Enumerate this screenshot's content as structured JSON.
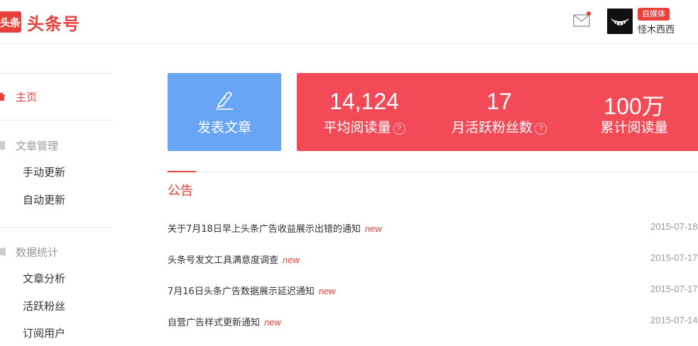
{
  "header": {
    "logo_mark": "头条",
    "logo_text": "头条号",
    "badge": "自媒体",
    "username": "怪木西西",
    "icons": [
      "mail-icon",
      "avatar"
    ]
  },
  "sidebar": {
    "home": "主页",
    "groups": [
      {
        "title": "文章管理",
        "items": [
          "手动更新",
          "自动更新"
        ]
      },
      {
        "title": "数据统计",
        "items": [
          "文章分析",
          "活跃粉丝",
          "订阅用户"
        ]
      }
    ]
  },
  "publish": {
    "label": "发表文章"
  },
  "stats": [
    {
      "value": "14,124",
      "label": "平均阅读量"
    },
    {
      "value": "17",
      "label": "月活跃粉丝数"
    },
    {
      "value": "100万",
      "label": "累计阅读量"
    }
  ],
  "announcements": {
    "title": "公告",
    "new_tag": "new",
    "items": [
      {
        "text": "关于7月18日早上头条广告收益展示出错的通知",
        "date": "2015-07-18"
      },
      {
        "text": "头条号发文工具满意度调查",
        "date": "2015-07-17"
      },
      {
        "text": "7月16日头条广告数据展示延迟通知",
        "date": "2015-07-17"
      },
      {
        "text": "自营广告样式更新通知",
        "date": "2015-07-14"
      }
    ]
  },
  "colors": {
    "brand_red": "#e8403a",
    "stats_bg": "#f24a57",
    "publish_bg": "#68a6f5"
  }
}
